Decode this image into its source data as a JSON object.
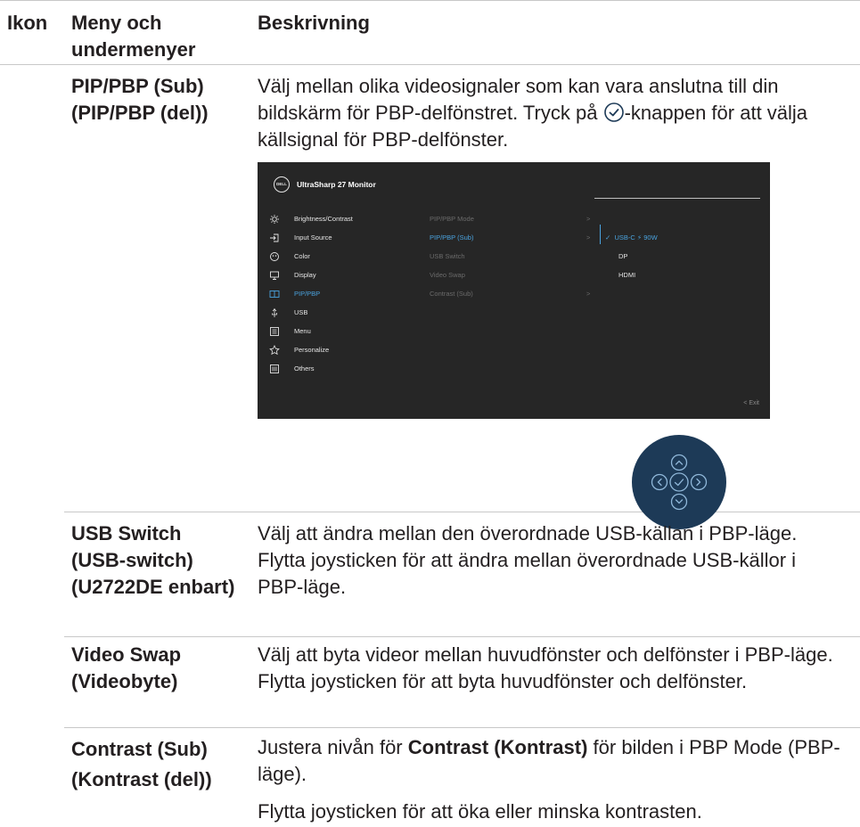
{
  "table": {
    "headers": {
      "icon": "Ikon",
      "menu": "Meny och undermenyer",
      "desc": "Beskrivning"
    },
    "rows": [
      {
        "name": "PIP/PBP (Sub) (PIP/PBP (del))",
        "desc_before": "Välj mellan olika videosignaler som kan vara anslutna till din bildskärm för PBP-delfönstret. Tryck på ",
        "desc_after": "-knappen för att välja källsignal för PBP-delfönster."
      },
      {
        "name": "USB Switch (USB-switch) (U2722DE enbart)",
        "desc": "Välj att ändra mellan den överordnade USB-källan i PBP-läge. Flytta joysticken för att ändra mellan överordnade USB-källor i PBP-läge."
      },
      {
        "name": "Video Swap (Videobyte)",
        "desc": "Välj att byta videor mellan huvudfönster och delfönster i PBP-läge. Flytta joysticken för att byta huvudfönster och delfönster."
      },
      {
        "name": "Contrast (Sub) (Kontrast (del))",
        "desc_p1_before": "Justera nivån för ",
        "desc_p1_bold": "Contrast (Kontrast)",
        "desc_p1_after": " för bilden i PBP Mode (PBP-läge).",
        "desc_p2": "Flytta joysticken för att öka eller minska kontrasten."
      }
    ]
  },
  "osd": {
    "logo": "DELL",
    "title": "UltraSharp 27 Monitor",
    "menu_items": [
      {
        "label": "Brightness/Contrast",
        "icon": "brightness-icon"
      },
      {
        "label": "Input Source",
        "icon": "input-source-icon"
      },
      {
        "label": "Color",
        "icon": "color-icon"
      },
      {
        "label": "Display",
        "icon": "display-icon"
      },
      {
        "label": "PIP/PBP",
        "icon": "pip-pbp-icon",
        "active": true
      },
      {
        "label": "USB",
        "icon": "usb-icon"
      },
      {
        "label": "Menu",
        "icon": "menu-icon"
      },
      {
        "label": "Personalize",
        "icon": "star-icon"
      },
      {
        "label": "Others",
        "icon": "others-icon"
      }
    ],
    "sub_items": [
      {
        "label": "PIP/PBP Mode",
        "chevron": ">"
      },
      {
        "label": "PIP/PBP (Sub)",
        "chevron": ">",
        "active": true
      },
      {
        "label": "USB Switch",
        "chevron": ""
      },
      {
        "label": "Video Swap",
        "chevron": ""
      },
      {
        "label": "Contrast (Sub)",
        "chevron": ">"
      }
    ],
    "options": [
      {
        "label": "USB-C ⚡ 90W",
        "selected": true
      },
      {
        "label": "DP"
      },
      {
        "label": "HDMI"
      }
    ],
    "exit_label": "< Exit",
    "accent_color": "#4aa3df",
    "background_color": "#262626"
  },
  "joystick": {
    "color": "#1d3a57",
    "icons": [
      "up-icon",
      "left-icon",
      "check-icon",
      "right-icon",
      "down-icon"
    ]
  }
}
